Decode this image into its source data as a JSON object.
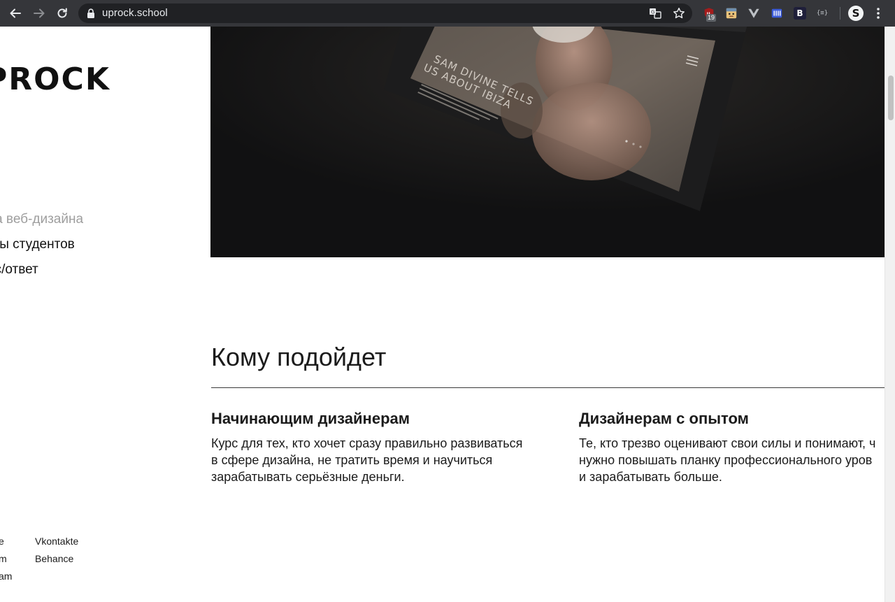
{
  "browser": {
    "url": "uprock.school",
    "extension_badge": "19",
    "profile_initial": "S",
    "ext_b_label": "B",
    "ext_braces_label": "{≡}"
  },
  "site": {
    "logo": "PROCK"
  },
  "nav": {
    "items": [
      {
        "label": "ла веб-дизайна",
        "muted": true
      },
      {
        "label": "кты студентов",
        "muted": false
      },
      {
        "label": "ос/ответ",
        "muted": false
      }
    ]
  },
  "hero": {
    "tablet_headline_1": "SAM DIVINE TELLS",
    "tablet_headline_2": "US ABOUT IBIZA"
  },
  "section": {
    "title": "Кому подойдет"
  },
  "cards": [
    {
      "title": "Начинающим дизайнерам",
      "lines": [
        "Курс для тех, кто хочет сразу правильно развиваться",
        "в сфере дизайна, не тратить время и научиться",
        "зарабатывать серьёзные деньги."
      ]
    },
    {
      "title": "Дизайнерам с опытом",
      "lines": [
        "Те, кто трезво оценивают свои силы и понимают, ч",
        "нужно повышать планку профессионального уров",
        "и зарабатывать больше."
      ]
    }
  ],
  "socials": {
    "col1": [
      "e",
      "m",
      "am"
    ],
    "col2": [
      "Vkontakte",
      "Behance"
    ]
  },
  "icons": {
    "back": "arrow-left-icon",
    "forward": "arrow-right-icon",
    "reload": "reload-icon",
    "lock": "lock-icon",
    "translate": "translate-icon",
    "bookmark": "star-icon",
    "menu": "kebab-menu-icon"
  },
  "colors": {
    "chrome_bg": "#35363a",
    "omnibox_bg": "#202124",
    "hero_bg": "#111112",
    "muted_text": "#9e9e9e"
  }
}
